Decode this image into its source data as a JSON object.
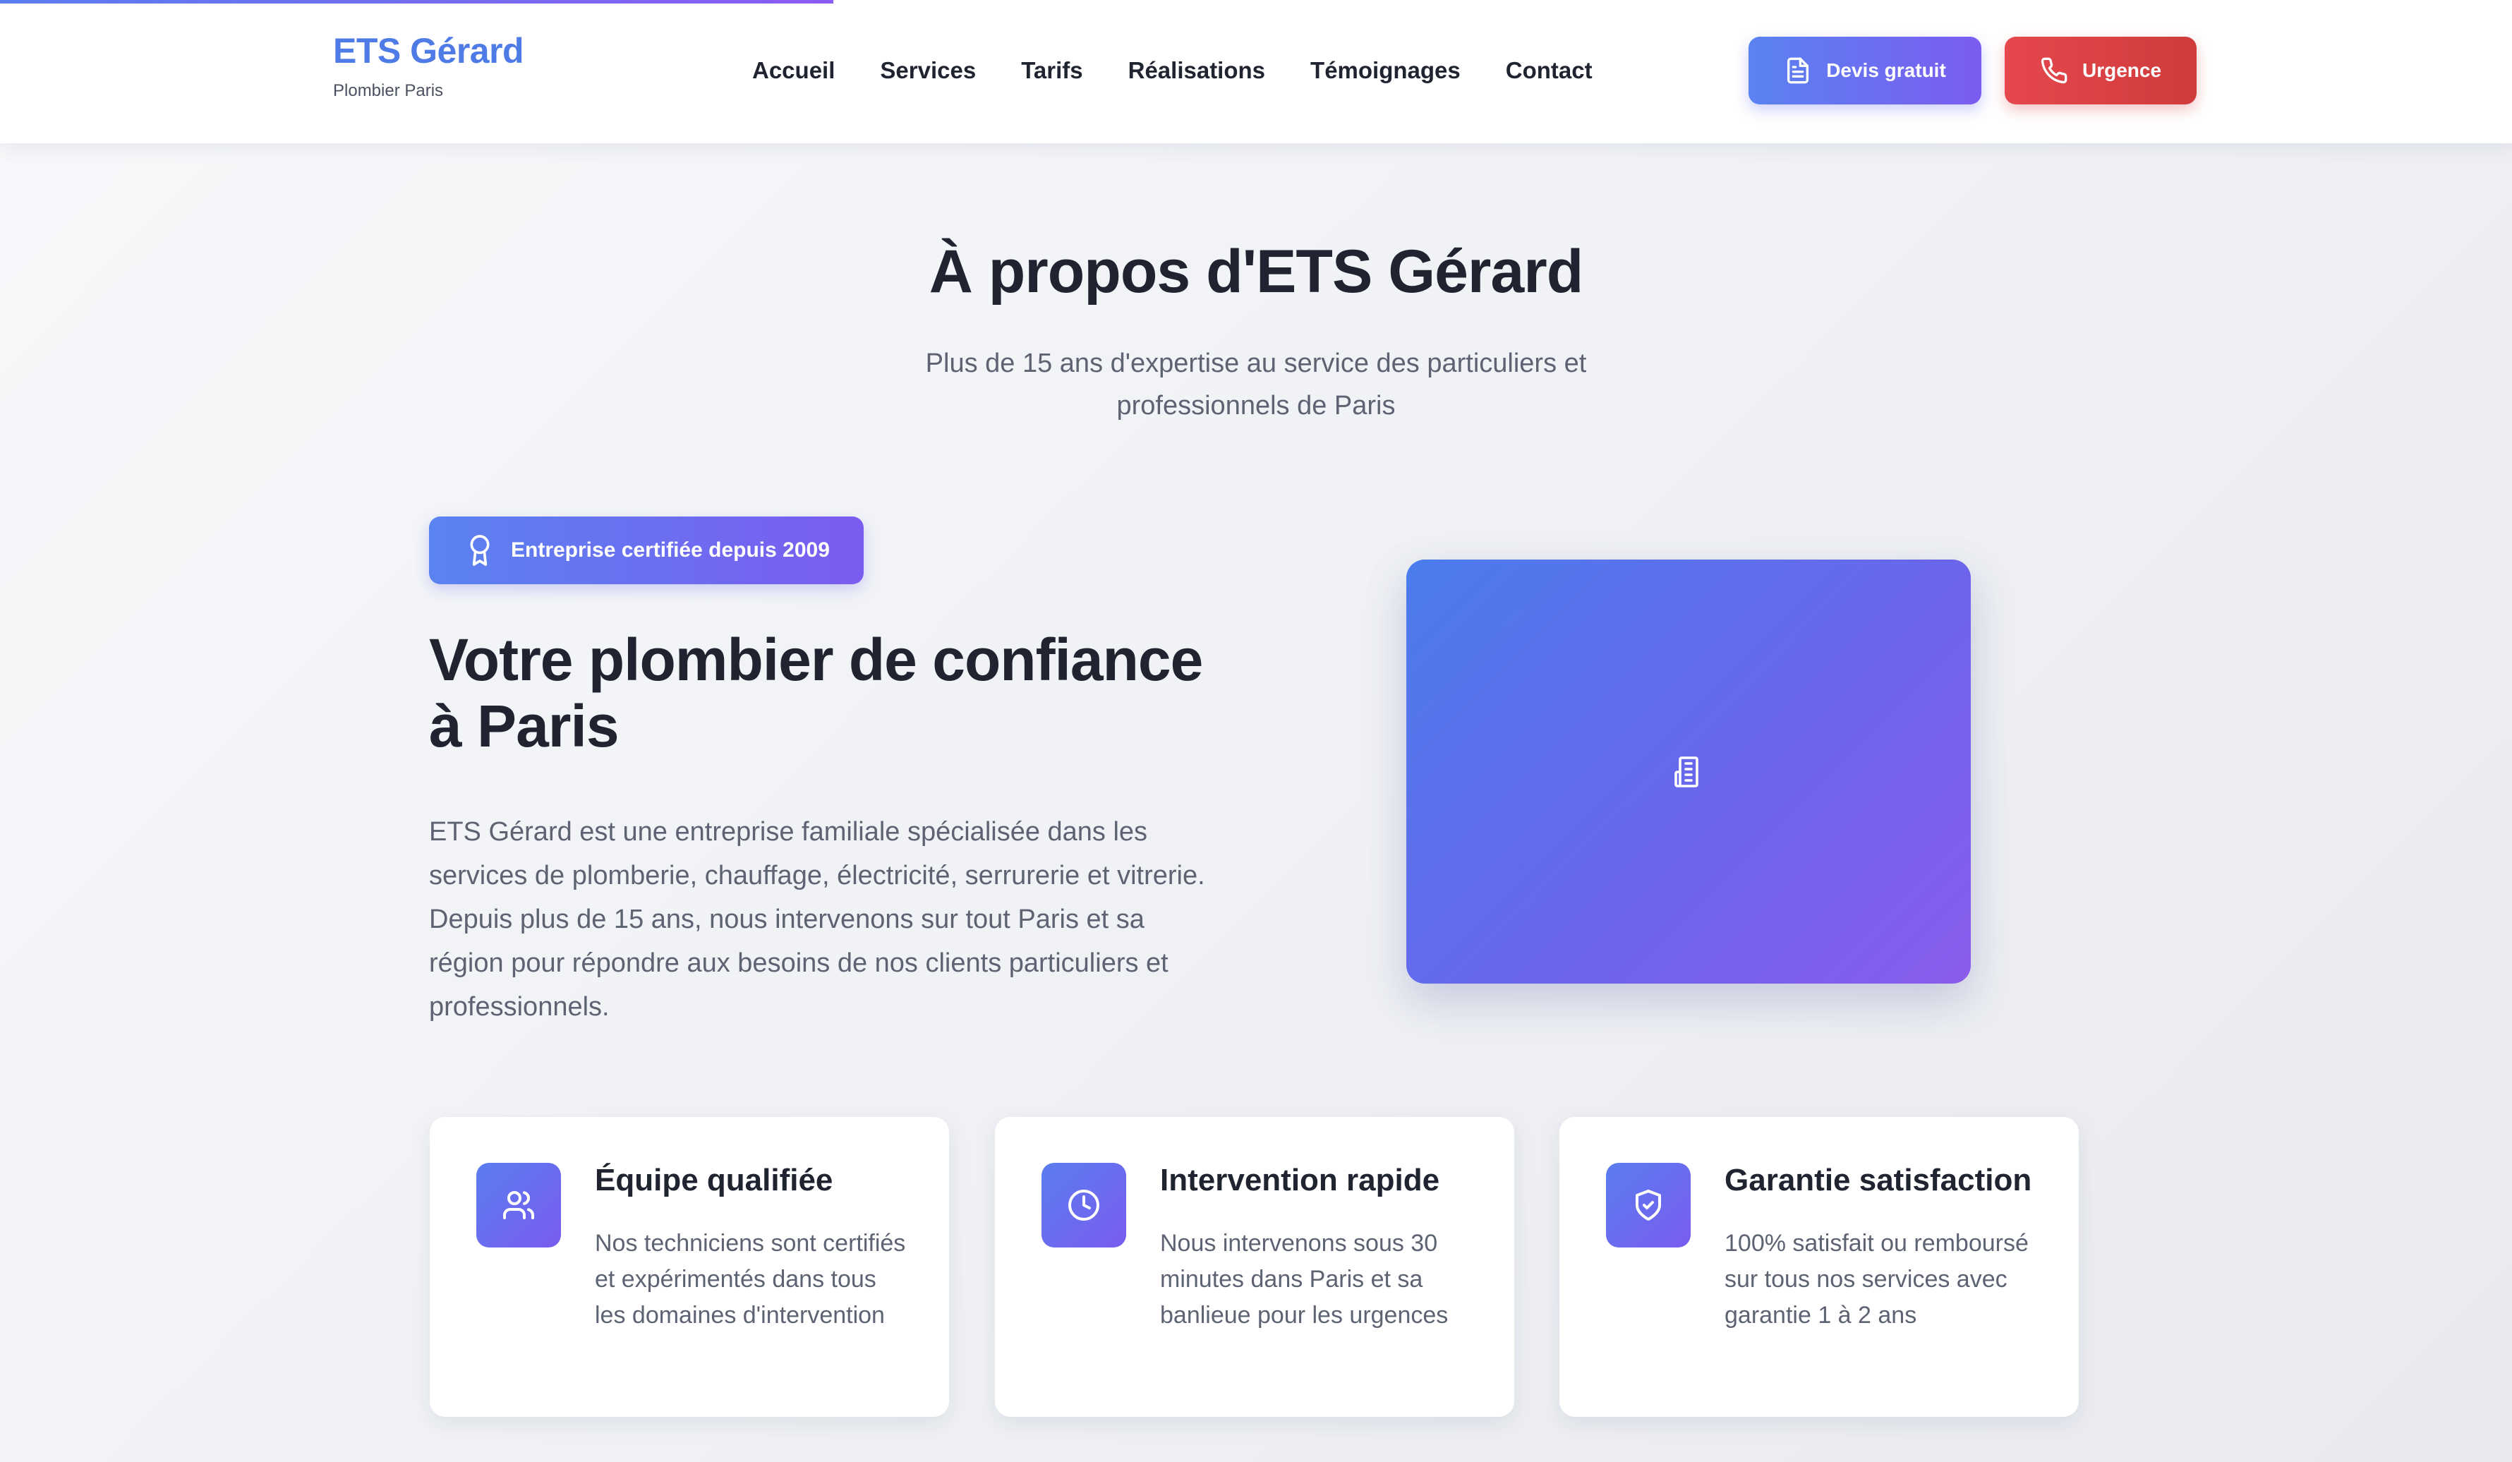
{
  "header": {
    "brand_name": "ETS Gérard",
    "brand_sub": "Plombier Paris",
    "nav": [
      "Accueil",
      "Services",
      "Tarifs",
      "Réalisations",
      "Témoignages",
      "Contact"
    ],
    "devis_label": "Devis gratuit",
    "urgence_label": "Urgence",
    "devis_icon": "document-icon",
    "urgence_icon": "phone-icon"
  },
  "about": {
    "title": "À propos d'ETS Gérard",
    "subtitle": "Plus de 15 ans d'expertise au service des particuliers et professionnels de Paris",
    "badge": "Entreprise certifiée depuis 2009",
    "badge_icon": "award-icon",
    "heading": "Votre plombier de confiance à Paris",
    "text": "ETS Gérard est une entreprise familiale spécialisée dans les services de plomberie, chauffage, électricité, serrurerie et vitrerie. Depuis plus de 15 ans, nous intervenons sur tout Paris et sa région pour répondre aux besoins de nos clients particuliers et professionnels.",
    "image_icon": "building-icon"
  },
  "features": [
    {
      "icon": "users-icon",
      "title": "Équipe qualifiée",
      "text": "Nos techniciens sont certifiés et expérimentés dans tous les domaines d'intervention"
    },
    {
      "icon": "clock-icon",
      "title": "Intervention rapide",
      "text": "Nous intervenons sous 30 minutes dans Paris et sa banlieue pour les urgences"
    },
    {
      "icon": "shield-check-icon",
      "title": "Garantie satisfaction",
      "text": "100% satisfait ou remboursé sur tous nos services avec garantie 1 à 2 ans"
    }
  ],
  "colors": {
    "brand_blue": "#4f7be6",
    "gradient_start": "#5a83f0",
    "gradient_end": "#7b5cf0",
    "urgence_red": "#e5484d",
    "text_dark": "#1f2430",
    "text_muted": "#5d6372"
  }
}
